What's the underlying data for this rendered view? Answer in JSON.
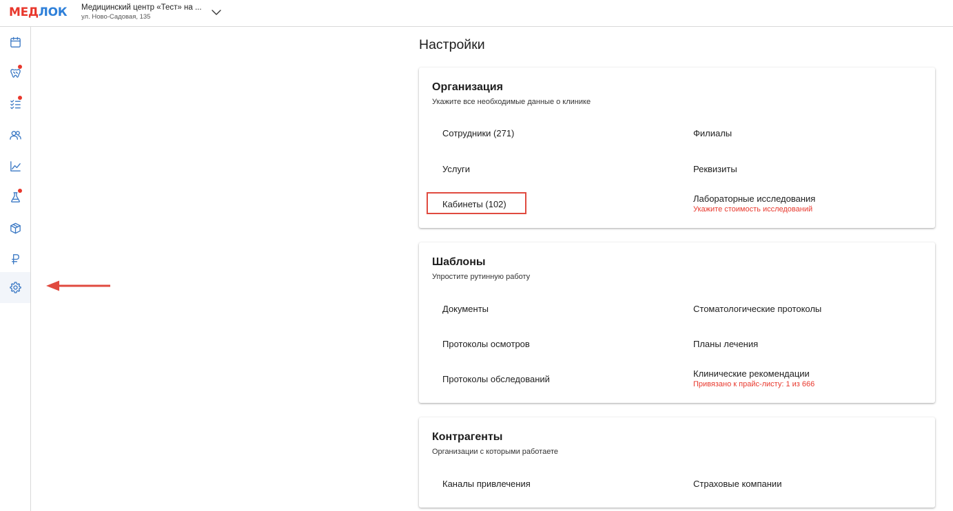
{
  "header": {
    "logo_part1": "МЕД",
    "logo_part2": "ЛОК",
    "clinic_name": "Медицинский центр «Тест» на ...",
    "clinic_address": "ул. Ново-Садовая, 135"
  },
  "sidebar": {
    "items": [
      {
        "icon": "calendar-icon",
        "badge": false
      },
      {
        "icon": "tooth-icon",
        "badge": true
      },
      {
        "icon": "tasks-icon",
        "badge": true
      },
      {
        "icon": "users-icon",
        "badge": false
      },
      {
        "icon": "chart-icon",
        "badge": false
      },
      {
        "icon": "flask-icon",
        "badge": true
      },
      {
        "icon": "box-icon",
        "badge": false
      },
      {
        "icon": "ruble-icon",
        "badge": false
      },
      {
        "icon": "gear-icon",
        "badge": false,
        "active": true
      }
    ],
    "badge_color": "#e8372c",
    "icon_color": "#3a78c4"
  },
  "page": {
    "title": "Настройки"
  },
  "sections": {
    "organization": {
      "title": "Организация",
      "subtitle": "Укажите все необходимые данные о клинике",
      "staff": "Сотрудники (271)",
      "branches": "Филиалы",
      "services": "Услуги",
      "requisites": "Реквизиты",
      "cabinets": "Кабинеты (102)",
      "lab": "Лабораторные исследования",
      "lab_warning": "Укажите стоимость исследований"
    },
    "templates": {
      "title": "Шаблоны",
      "subtitle": "Упростите рутинную работу",
      "documents": "Документы",
      "dental_protocols": "Стоматологические протоколы",
      "exam_protocols": "Протоколы осмотров",
      "treatment_plans": "Планы лечения",
      "survey_protocols": "Протоколы обследований",
      "clinical_recs": "Клинические рекомендации",
      "clinical_recs_warning": "Привязано к прайс-листу: 1 из 666"
    },
    "counterparties": {
      "title": "Контрагенты",
      "subtitle": "Организации с которыми работаете",
      "channels": "Каналы привлечения",
      "insurance": "Страховые компании"
    }
  },
  "colors": {
    "accent_red": "#e8372c",
    "brand_blue": "#2f80d9"
  }
}
